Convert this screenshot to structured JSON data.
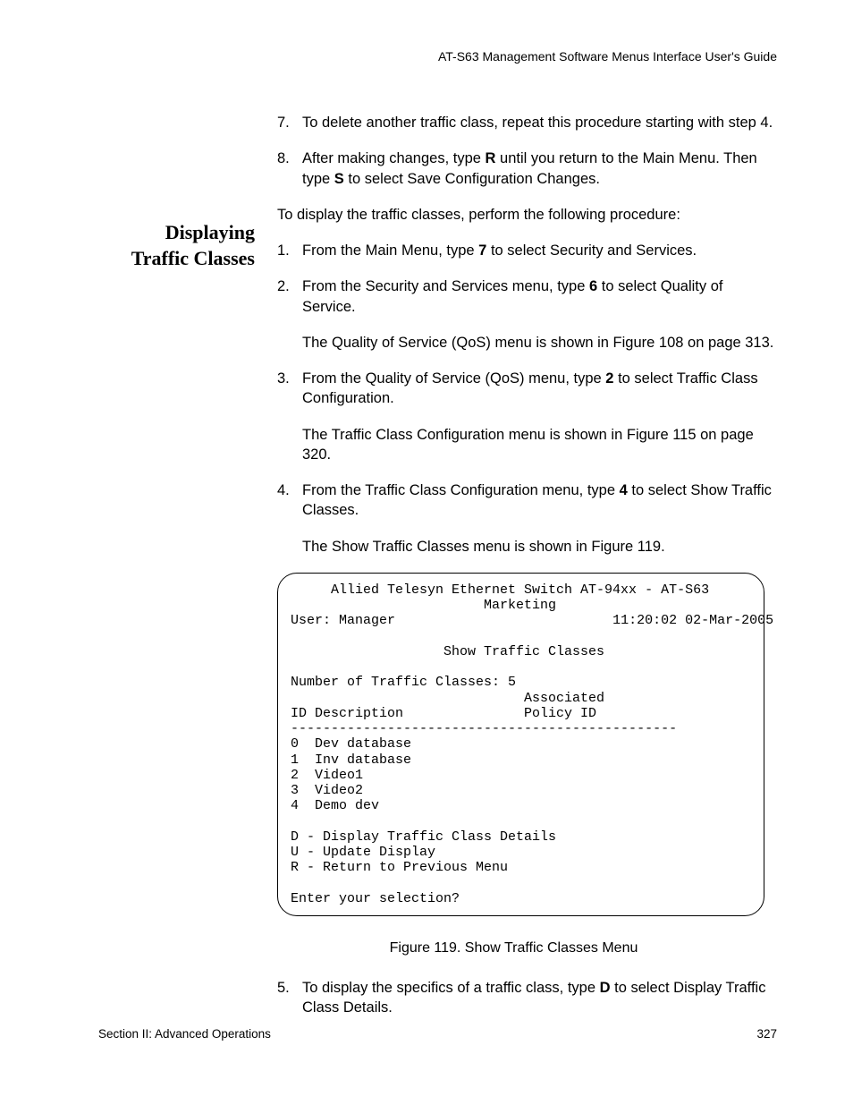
{
  "header": "AT-S63 Management Software Menus Interface User's Guide",
  "margin_heading_line1": "Displaying",
  "margin_heading_line2": "Traffic Classes",
  "steps_top": [
    {
      "num": "7.",
      "text_a": "To delete another traffic class, repeat this procedure starting with step 4."
    },
    {
      "num": "8.",
      "text_a": "After making changes, type ",
      "bold1": "R",
      "text_b": " until you return to the Main Menu. Then type ",
      "bold2": "S",
      "text_c": " to select Save Configuration Changes."
    }
  ],
  "intro": "To display the traffic classes, perform the following procedure:",
  "steps_main": [
    {
      "num": "1.",
      "text_a": "From the Main Menu, type ",
      "bold1": "7",
      "text_b": " to select Security and Services."
    },
    {
      "num": "2.",
      "text_a": "From the Security and Services menu, type ",
      "bold1": "6",
      "text_b": " to select Quality of Service.",
      "sub": "The Quality of Service (QoS) menu is shown in Figure 108 on page 313."
    },
    {
      "num": "3.",
      "text_a": "From the Quality of Service (QoS) menu, type ",
      "bold1": "2",
      "text_b": " to select Traffic Class Configuration.",
      "sub": "The Traffic Class Configuration menu is shown in Figure 115 on page 320."
    },
    {
      "num": "4.",
      "text_a": "From the Traffic Class Configuration menu, type ",
      "bold1": "4",
      "text_b": " to select Show Traffic Classes.",
      "sub": "The Show Traffic Classes menu is shown in Figure 119."
    }
  ],
  "terminal": {
    "title_line": "     Allied Telesyn Ethernet Switch AT-94xx - AT-S63",
    "subtitle_line": "                        Marketing",
    "user_label": "User: Manager",
    "timestamp": "11:20:02 02-Mar-2005",
    "screen_name": "                   Show Traffic Classes",
    "count_line": "Number of Traffic Classes: 5",
    "col_header1": "                             Associated",
    "col_header2": "ID Description               Policy ID",
    "divider": "------------------------------------------------",
    "rows": [
      "0  Dev database",
      "1  Inv database",
      "2  Video1",
      "3  Video2",
      "4  Demo dev"
    ],
    "menu": [
      "D - Display Traffic Class Details",
      "U - Update Display",
      "R - Return to Previous Menu"
    ],
    "prompt": "Enter your selection?"
  },
  "figure_caption": "Figure 119. Show Traffic Classes Menu",
  "step5": {
    "num": "5.",
    "text_a": "To display the specifics of a traffic class, type ",
    "bold1": "D",
    "text_b": " to select Display Traffic Class Details."
  },
  "footer_left": "Section II: Advanced Operations",
  "footer_right": "327"
}
